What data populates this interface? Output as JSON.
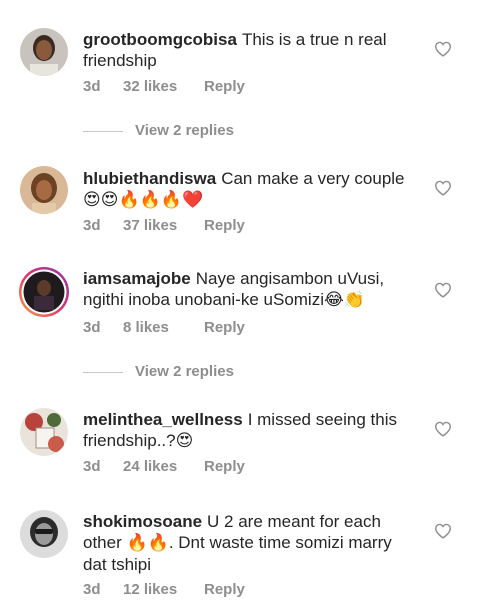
{
  "comments": [
    {
      "username": "grootboomgcobisa",
      "text": "This is a true n real friendship",
      "time": "3d",
      "likes": "32 likes",
      "reply": "Reply",
      "view_replies": "View 2 replies"
    },
    {
      "username": "hlubiethandiswa",
      "text": "Can make a very couple",
      "emoji": "😍😍🔥🔥🔥❤️",
      "time": "3d",
      "likes": "37 likes",
      "reply": "Reply"
    },
    {
      "username": "iamsamajobe",
      "text": "Naye angisambon uVusi, ngithi inoba unobani-ke uSomizi",
      "emoji": "😂👏",
      "time": "3d",
      "likes": "8 likes",
      "reply": "Reply",
      "view_replies": "View 2 replies"
    },
    {
      "username": "melinthea_wellness",
      "text": "I missed seeing this friendship..?",
      "emoji": "😍",
      "time": "3d",
      "likes": "24 likes",
      "reply": "Reply"
    },
    {
      "username": "shokimosoane",
      "text": "U 2 are meant for each other",
      "emoji": "🔥🔥",
      "text2": ". Dnt waste time somizi marry dat tshipi",
      "time": "3d",
      "likes": "12 likes",
      "reply": "Reply"
    }
  ],
  "icons": {
    "like": "heart-outline-icon"
  }
}
